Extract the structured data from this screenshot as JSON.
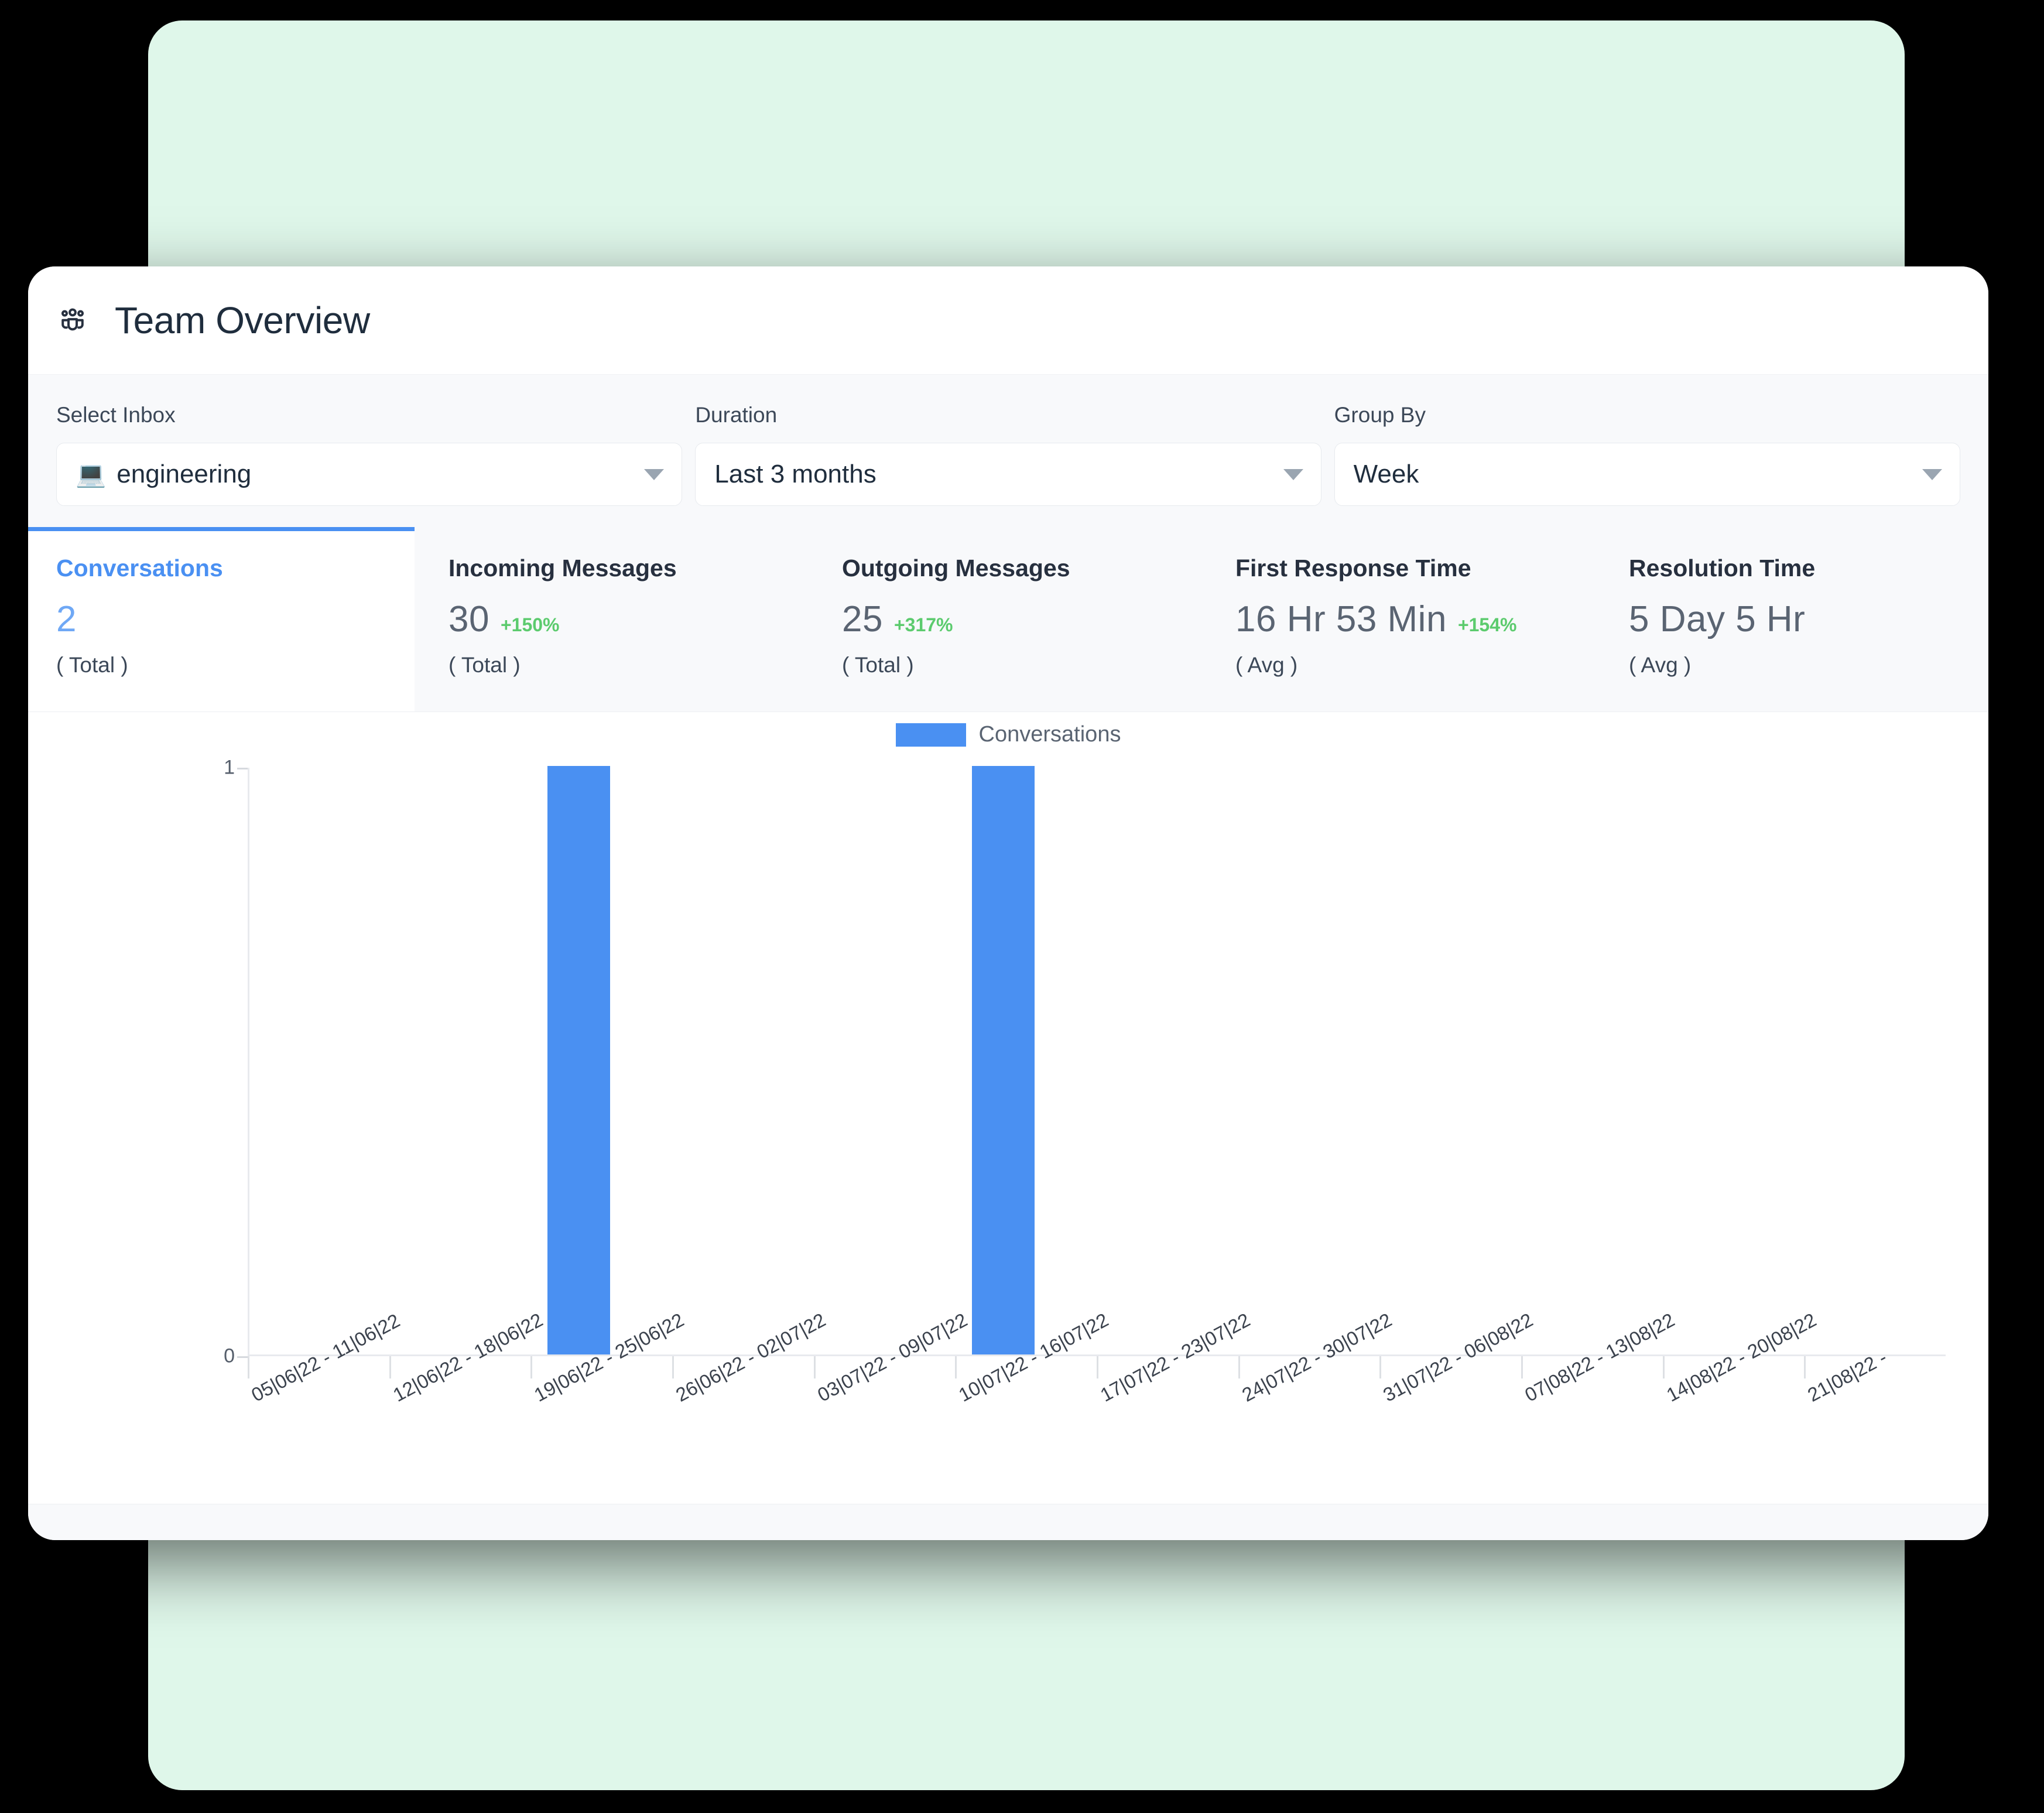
{
  "header": {
    "title": "Team Overview",
    "icon": "people-group-icon"
  },
  "filters": [
    {
      "label": "Select Inbox",
      "value": "engineering",
      "emoji": "💻",
      "icon": "laptop-icon",
      "name": "select-inbox"
    },
    {
      "label": "Duration",
      "value": "Last 3 months",
      "emoji": "",
      "icon": "",
      "name": "duration"
    },
    {
      "label": "Group By",
      "value": "Week",
      "emoji": "",
      "icon": "",
      "name": "group-by"
    }
  ],
  "metrics": [
    {
      "title": "Conversations",
      "value": "2",
      "delta": "",
      "sub": "( Total )",
      "active": true
    },
    {
      "title": "Incoming Messages",
      "value": "30",
      "delta": "+150%",
      "sub": "( Total )",
      "active": false
    },
    {
      "title": "Outgoing Messages",
      "value": "25",
      "delta": "+317%",
      "sub": "( Total )",
      "active": false
    },
    {
      "title": "First Response Time",
      "value": "16 Hr 53 Min",
      "delta": "+154%",
      "sub": "( Avg )",
      "active": false
    },
    {
      "title": "Resolution Time",
      "value": "5 Day 5 Hr",
      "delta": "",
      "sub": "( Avg )",
      "active": false
    }
  ],
  "colors": {
    "accent": "#4A90F2",
    "positive": "#5CCB6E",
    "backdrop": "#DFF7EA",
    "card": "#FFFFFF",
    "panel": "#F8F9FB",
    "text": "#1F2D3D"
  },
  "chart_data": {
    "type": "bar",
    "title": "",
    "xlabel": "",
    "ylabel": "",
    "legend": [
      "Conversations"
    ],
    "legend_position": "top-center",
    "grid": false,
    "ylim": [
      0,
      1
    ],
    "yticks": [
      "0",
      "1"
    ],
    "categories": [
      "05|06|22 - 11|06|22",
      "12|06|22 - 18|06|22",
      "19|06|22 - 25|06|22",
      "26|06|22 - 02|07|22",
      "03|07|22 - 09|07|22",
      "10|07|22 - 16|07|22",
      "17|07|22 - 23|07|22",
      "24|07|22 - 30|07|22",
      "31|07|22 - 06|08|22",
      "07|08|22 - 13|08|22",
      "14|08|22 - 20|08|22",
      "21|08|22 - "
    ],
    "series": [
      {
        "name": "Conversations",
        "color": "#4A90F2",
        "values": [
          0,
          0,
          1,
          0,
          0,
          1,
          0,
          0,
          0,
          0,
          0,
          0
        ]
      }
    ]
  }
}
